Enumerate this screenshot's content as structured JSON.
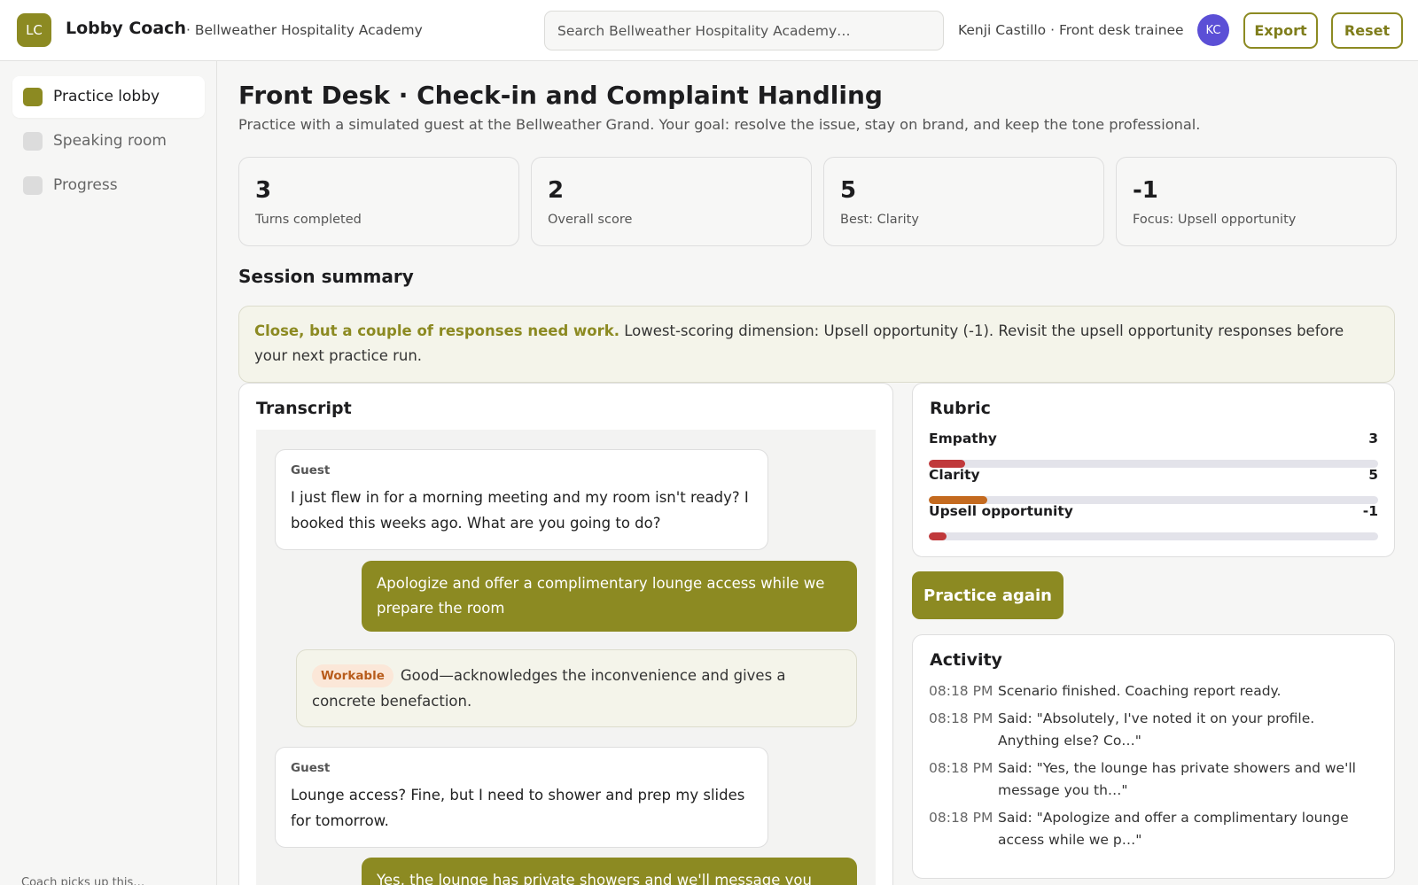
{
  "header": {
    "logo_initials": "LC",
    "app_title": "Lobby Coach",
    "org_name": "· Bellweather Hospitality Academy",
    "search_placeholder": "Search Bellweather Hospitality Academy…",
    "user_label": "Kenji Castillo · Front desk trainee",
    "user_initials": "KC",
    "export_label": "Export",
    "reset_label": "Reset"
  },
  "sidebar": {
    "items": [
      {
        "label": "Practice lobby",
        "active": true
      },
      {
        "label": "Speaking room",
        "active": false
      },
      {
        "label": "Progress",
        "active": false
      }
    ],
    "footer_text": "Coach picks up this…"
  },
  "main": {
    "title": "Front Desk · Check-in and Complaint Handling",
    "subtitle": "Practice with a simulated guest at the Bellweather Grand. Your goal: resolve the issue, stay on brand, and keep the tone professional.",
    "stats": [
      {
        "value": "3",
        "label": "Turns completed"
      },
      {
        "value": "2",
        "label": "Overall score"
      },
      {
        "value": "5",
        "label": "Best: Clarity"
      },
      {
        "value": "-1",
        "label": "Focus: Upsell opportunity"
      }
    ],
    "summary_title": "Session summary",
    "summary": {
      "lead": "Close, but a couple of responses need work.",
      "body": "Lowest-scoring dimension: Upsell opportunity (-1). Revisit the upsell opportunity responses before your next practice run."
    }
  },
  "transcript": {
    "title": "Transcript",
    "guest_label": "Guest",
    "messages": [
      {
        "speaker": "Guest",
        "text": "I just flew in for a morning meeting and my room isn't ready? I booked this weeks ago. What are you going to do?"
      },
      {
        "text": "Apologize and offer a complimentary lounge access while we prepare the room"
      },
      {
        "badge": "Workable",
        "text": "Good—acknowledges the inconvenience and gives a concrete benefaction."
      },
      {
        "speaker": "Guest",
        "text": "Lounge access? Fine, but I need to shower and prep my slides for tomorrow."
      },
      {
        "text": "Yes, the lounge has private showers and we'll message you th…"
      }
    ]
  },
  "rubric": {
    "title": "Rubric",
    "items": [
      {
        "name": "Empathy",
        "score": "3",
        "fill_fraction": 0.08,
        "color": "#c0393b"
      },
      {
        "name": "Clarity",
        "score": "5",
        "fill_fraction": 0.13,
        "color": "#c46a1f"
      },
      {
        "name": "Upsell opportunity",
        "score": "-1",
        "fill_fraction": 0.04,
        "color": "#c0393b"
      }
    ]
  },
  "practice_again_label": "Practice again",
  "activity": {
    "title": "Activity",
    "items": [
      {
        "time": "08:18 PM",
        "text": "Scenario finished. Coaching report ready."
      },
      {
        "time": "08:18 PM",
        "text": "Said: \"Absolutely, I've noted it on your profile. Anything else? Co…\""
      },
      {
        "time": "08:18 PM",
        "text": "Said: \"Yes, the lounge has private showers and we'll message you th…\""
      },
      {
        "time": "08:18 PM",
        "text": "Said: \"Apologize and offer a complimentary lounge access while we p…\""
      }
    ]
  },
  "colors": {
    "accent": "#8c8a22",
    "avatar": "#5b4fd6",
    "badge_bg": "#fbe7d8",
    "badge_text": "#b85c1c"
  }
}
